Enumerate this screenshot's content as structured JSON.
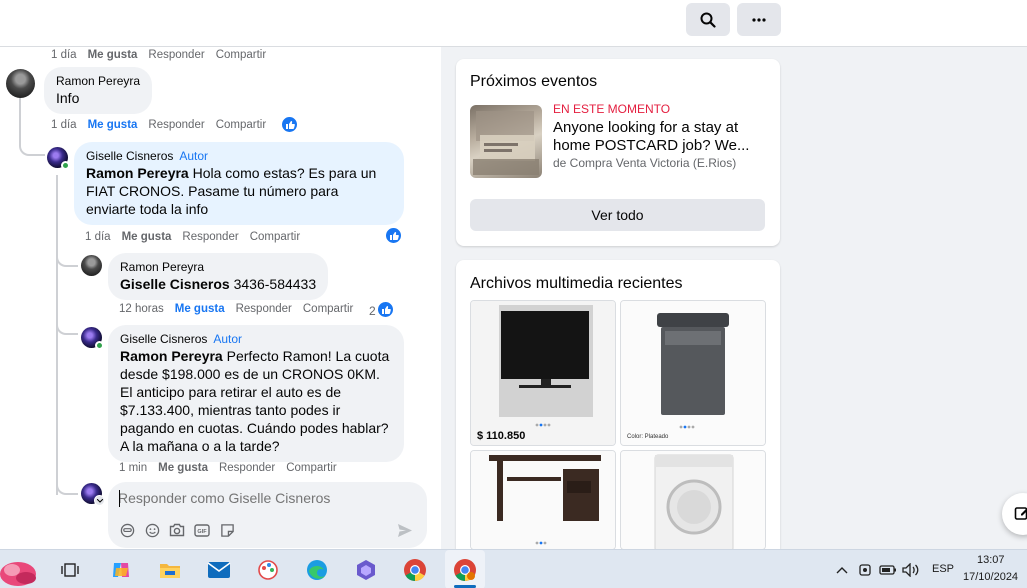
{
  "header": {
    "search_icon": "search-icon",
    "more_icon": "more-horizontal-icon"
  },
  "comments": {
    "top_meta": {
      "time": "1 día",
      "like": "Me gusta",
      "reply": "Responder",
      "share": "Compartir"
    },
    "c1": {
      "author": "Ramon Pereyra",
      "text": "Info",
      "time": "1 día",
      "like": "Me gusta",
      "reply": "Responder",
      "share": "Compartir"
    },
    "c2": {
      "author": "Giselle Cisneros",
      "badge": "Autor",
      "mention": "Ramon Pereyra",
      "text": " Hola como estas? Es para un FIAT CRONOS. Pasame tu número para enviarte toda la info",
      "time": "1 día",
      "like": "Me gusta",
      "reply": "Responder",
      "share": "Compartir"
    },
    "c3": {
      "author": "Ramon Pereyra",
      "mention": "Giselle Cisneros",
      "text": " 3436-584433",
      "time": "12 horas",
      "like": "Me gusta",
      "reply": "Responder",
      "share": "Compartir",
      "reactions": "2"
    },
    "c4": {
      "author": "Giselle Cisneros",
      "badge": "Autor",
      "mention": "Ramon Pereyra",
      "text": " Perfecto Ramon! La cuota desde $198.000 es de un CRONOS 0KM. El anticipo para retirar el auto es de $7.133.400, mientras tanto podes ir pagando en cuotas. Cuándo podes hablar? A la mañana o a la tarde?",
      "time": "1 min",
      "like": "Me gusta",
      "reply": "Responder",
      "share": "Compartir"
    },
    "reply_placeholder": "Responder como Giselle Cisneros"
  },
  "events": {
    "title": "Próximos eventos",
    "live": "EN ESTE MOMENTO",
    "event_title": "Anyone looking for a stay at home POSTCARD job? We...",
    "event_by": "de Compra Venta Victoria (E.Rios)",
    "see_all": "Ver todo"
  },
  "media": {
    "title": "Archivos multimedia recientes",
    "items": [
      {
        "kind": "tv",
        "price": "$ 110.850"
      },
      {
        "kind": "washer",
        "caption": "Color: Plateado"
      },
      {
        "kind": "desk"
      },
      {
        "kind": "dryer"
      }
    ]
  },
  "taskbar": {
    "language": "ESP",
    "time": "13:07",
    "date": "17/10/2024"
  },
  "colors": {
    "accent": "#1876f2",
    "live_red": "#e41e3f",
    "online_green": "#31a24c"
  }
}
